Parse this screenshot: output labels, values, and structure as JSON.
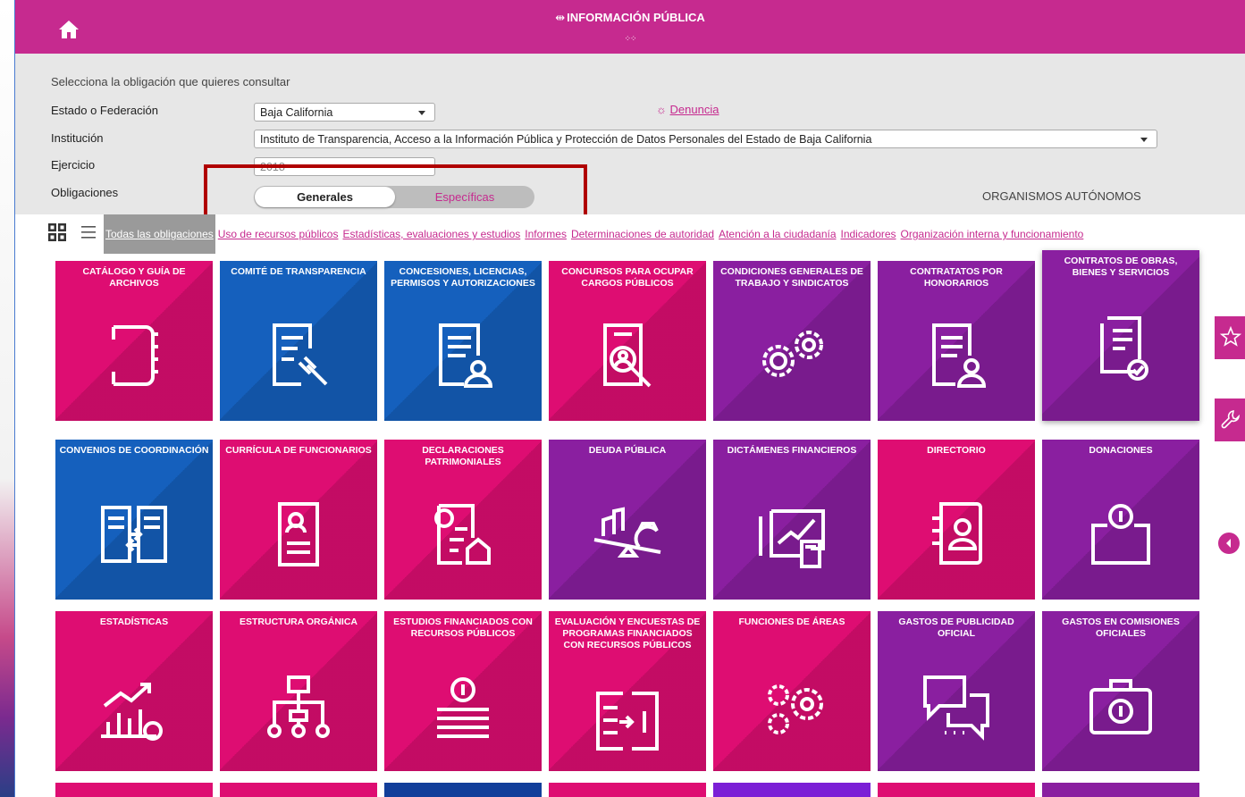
{
  "header": {
    "title": "INFORMACIÓN PÚBLICA",
    "title_glyph": "⇹",
    "dots": "⁘⁘"
  },
  "form": {
    "prompt": "Selecciona la obligación que quieres consultar",
    "estado_label": "Estado o Federación",
    "estado_value": "Baja California",
    "institucion_label": "Institución",
    "institucion_value": "Instituto de Transparencia, Acceso a la Información Pública y Protección de Datos Personales del Estado de Baja California",
    "ejercicio_label": "Ejercicio",
    "ejercicio_value": "2018",
    "obligaciones_label": "Obligaciones",
    "toggle_on": "Generales",
    "toggle_off": "Específicas",
    "denuncia_icon": "☼",
    "denuncia_label": "Denuncia",
    "organismos": "ORGANISMOS AUTÓNOMOS"
  },
  "filters": [
    "Todas las obligaciones",
    "Uso de recursos públicos",
    "Estadísticas, evaluaciones y estudios",
    "Informes",
    "Determinaciones de autoridad",
    "Atención a la ciudadanía",
    "Indicadores",
    "Organización interna y funcionamiento"
  ],
  "tiles": [
    {
      "title": "Catálogo y guía de archivos",
      "color": "pink",
      "icon": "binder-icon"
    },
    {
      "title": "Comité de transparencia",
      "color": "blue",
      "icon": "gavel-document-icon"
    },
    {
      "title": "Concesiones, licencias, permisos y autorizaciones",
      "color": "blue",
      "icon": "document-user-icon"
    },
    {
      "title": "Concursos para ocupar cargos públicos",
      "color": "pink",
      "icon": "document-search-icon"
    },
    {
      "title": "Condiciones generales de trabajo y sindicatos",
      "color": "purple",
      "icon": "gears-money-icon"
    },
    {
      "title": "Contratatos por honorarios",
      "color": "purple",
      "icon": "document-person-icon"
    },
    {
      "title": "Contratos de obras, bienes y servicios",
      "color": "purple",
      "icon": "documents-check-icon"
    },
    {
      "title": "Convenios de coordinación",
      "color": "blue",
      "icon": "exchange-documents-icon"
    },
    {
      "title": "Currícula de funcionarios",
      "color": "pink",
      "icon": "resume-icon"
    },
    {
      "title": "Declaraciones patrimoniales",
      "color": "pink",
      "icon": "declaration-house-icon"
    },
    {
      "title": "Deuda pública",
      "color": "purple",
      "icon": "balance-money-icon"
    },
    {
      "title": "Dictámenes financieros",
      "color": "purple",
      "icon": "financial-chart-icon"
    },
    {
      "title": "Directorio",
      "color": "pink",
      "icon": "address-book-icon"
    },
    {
      "title": "Donaciones",
      "color": "purple",
      "icon": "donation-box-icon"
    },
    {
      "title": "Estadísticas",
      "color": "pink",
      "icon": "statistics-icon"
    },
    {
      "title": "Estructura orgánica",
      "color": "pink",
      "icon": "org-chart-icon"
    },
    {
      "title": "Estudios financiados con recursos públicos",
      "color": "pink",
      "icon": "coin-books-icon"
    },
    {
      "title": "Evaluación y encuestas de programas financiados con recursos públicos",
      "color": "pink",
      "icon": "checklist-money-icon"
    },
    {
      "title": "Funciones de áreas",
      "color": "pink",
      "icon": "gears-icon"
    },
    {
      "title": "Gastos de publicidad oficial",
      "color": "purple",
      "icon": "chat-bubbles-icon"
    },
    {
      "title": "Gastos en comisiones oficiales",
      "color": "purple",
      "icon": "briefcase-money-icon"
    }
  ]
}
